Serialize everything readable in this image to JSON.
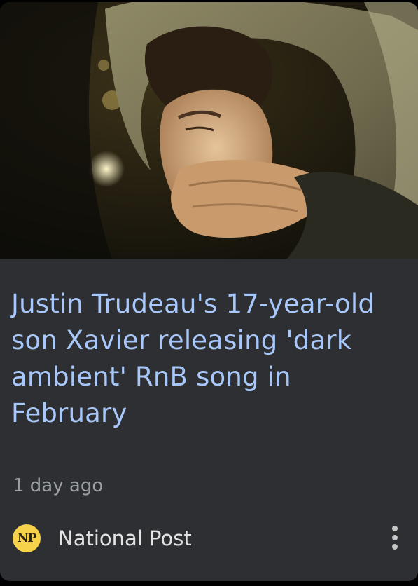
{
  "article": {
    "image_description": "photo",
    "headline": "Justin Trudeau's 17-year-old son Xavier releasing 'dark ambient' RnB song in February",
    "time_ago": "1 day ago"
  },
  "source": {
    "logo_text": "NP",
    "name": "National Post"
  },
  "colors": {
    "card_background": "#2e2f33",
    "headline": "#a8c7fa",
    "meta_text": "#9aa0a6",
    "source_text": "#e3e3e3",
    "logo_background": "#f6d24a"
  },
  "icons": {
    "more_options": "more-vert-icon"
  }
}
